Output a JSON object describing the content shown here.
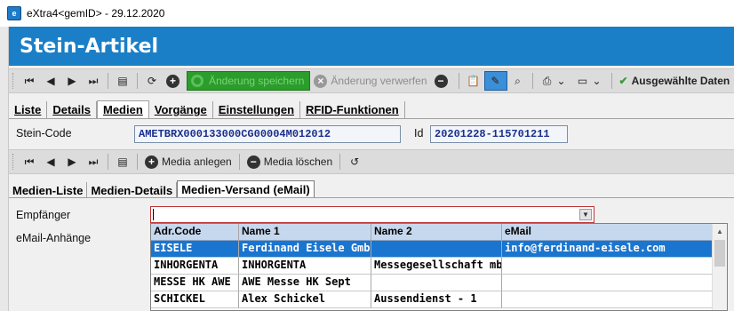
{
  "window": {
    "title": "eXtra4<gemID>  - 29.12.2020",
    "app_icon": "app-logo-icon"
  },
  "header": {
    "title": "Stein-Artikel",
    "bg": "#1a7fc7"
  },
  "toolbar": {
    "save_label": "Änderung speichern",
    "discard_label": "Änderung verwerfen",
    "selected_label": "Ausgewählte Daten"
  },
  "tabs": [
    "Liste",
    "Details",
    "Medien",
    "Vorgänge",
    "Einstellungen",
    "RFID-Funktionen"
  ],
  "form": {
    "stein_code_label": "Stein-Code",
    "stein_code_value": "AMETBRX000133000CG00004M012012",
    "id_label": "Id",
    "id_value": "20201228-115701211"
  },
  "media_toolbar": {
    "add_label": "Media anlegen",
    "delete_label": "Media löschen"
  },
  "subtabs": [
    "Medien-Liste",
    "Medien-Details",
    "Medien-Versand (eMail)"
  ],
  "mail": {
    "recipient_label": "Empfänger",
    "attachments_label": "eMail-Anhänge",
    "recipient_value": ""
  },
  "grid": {
    "columns": [
      "Adr.Code",
      "Name 1",
      "Name 2",
      "eMail"
    ],
    "rows": [
      [
        "EISELE",
        "Ferdinand Eisele Gmb",
        "",
        "info@ferdinand-eisele.com"
      ],
      [
        "INHORGENTA",
        "INHORGENTA",
        "Messegesellschaft mb",
        ""
      ],
      [
        "MESSE HK AWE",
        "AWE Messe HK Sept",
        "",
        ""
      ],
      [
        "SCHICKEL",
        "Alex Schickel",
        "Aussendienst - 1",
        ""
      ]
    ],
    "selected_row": 0
  },
  "colors": {
    "accent": "#1a7fc7",
    "selection": "#1a75cf",
    "save_green": "#2a9d2a"
  }
}
